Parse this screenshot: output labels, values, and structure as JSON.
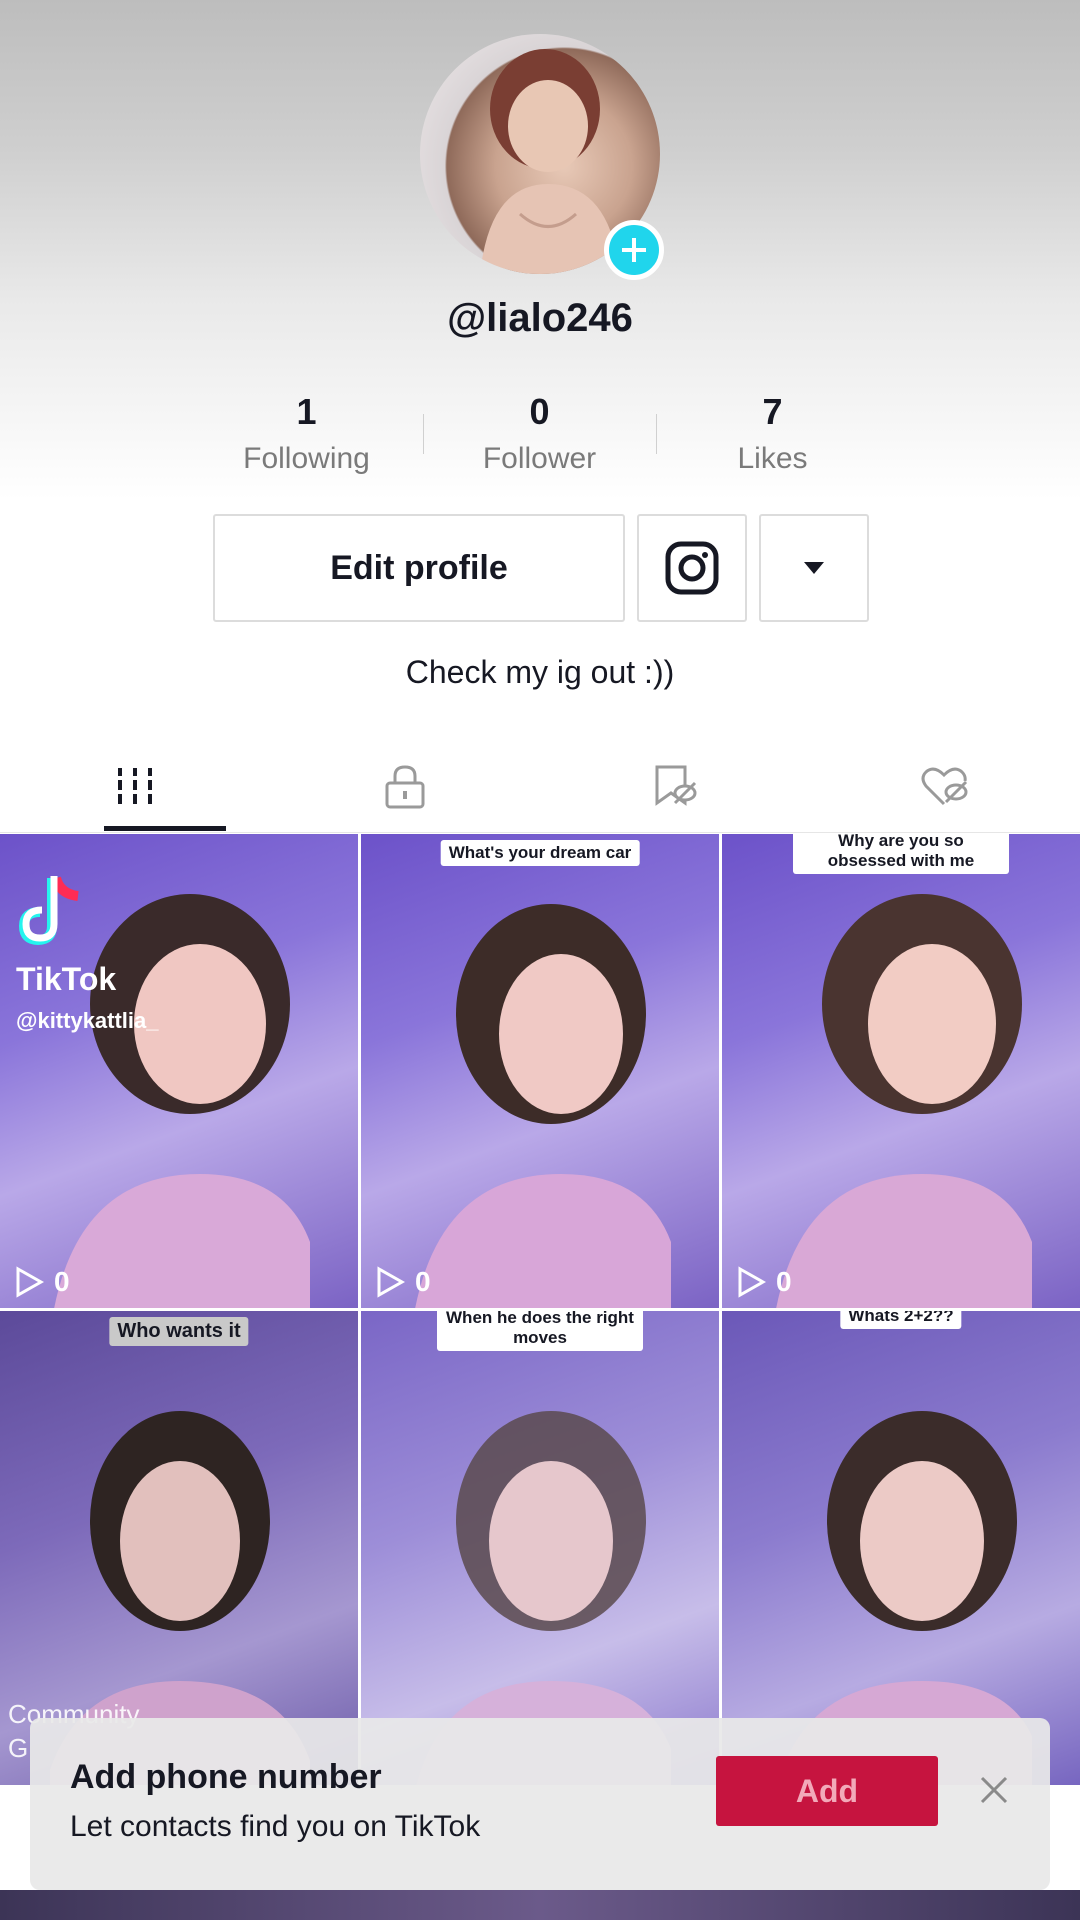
{
  "profile": {
    "username": "@lialo246",
    "bio": "Check my ig out :))"
  },
  "stats": [
    {
      "value": "1",
      "label": "Following"
    },
    {
      "value": "0",
      "label": "Follower"
    },
    {
      "value": "7",
      "label": "Likes"
    }
  ],
  "actions": {
    "edit_label": "Edit profile"
  },
  "tabs": [
    {
      "name": "videos",
      "icon": "grid-icon",
      "active": true
    },
    {
      "name": "private",
      "icon": "lock-icon"
    },
    {
      "name": "favorites",
      "icon": "bookmark-hidden-icon"
    },
    {
      "name": "liked",
      "icon": "heart-hidden-icon"
    }
  ],
  "videos": [
    {
      "caption": "",
      "views": "0",
      "watermark_brand": "TikTok",
      "watermark_handle": "@kittykattlia_"
    },
    {
      "caption": "What's your dream car",
      "views": "0"
    },
    {
      "caption": "Why are you so obsessed with me",
      "views": "0"
    },
    {
      "caption": "Who wants it",
      "overlay_text": "Community G"
    },
    {
      "caption": "When he does the right moves"
    },
    {
      "caption": "Whats 2+2??"
    }
  ],
  "toast": {
    "title": "Add phone number",
    "subtitle": "Let contacts find you on TikTok",
    "button": "Add"
  },
  "colors": {
    "accent": "#20d5ec",
    "primary": "#c6143f",
    "text": "#161823"
  }
}
